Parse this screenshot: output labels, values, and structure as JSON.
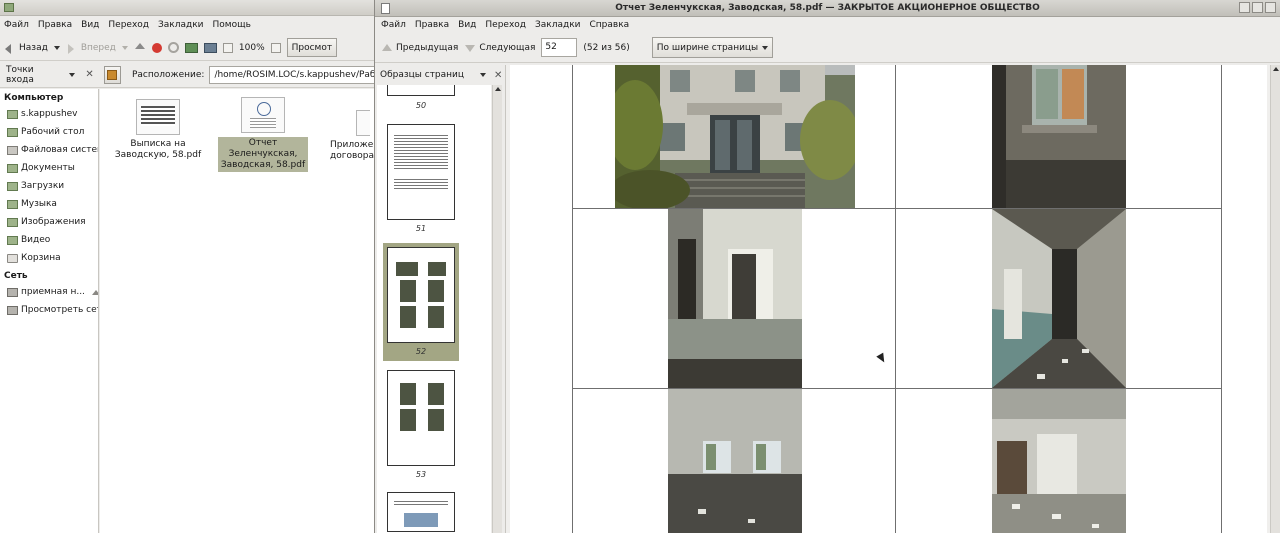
{
  "file_manager": {
    "menu": [
      "Файл",
      "Правка",
      "Вид",
      "Переход",
      "Закладки",
      "Помощь"
    ],
    "toolbar": {
      "back": "Назад",
      "forward": "Вперед",
      "zoom": "100%",
      "view": "Просмот"
    },
    "location": {
      "places_label": "Точки входа",
      "location_label": "Расположение:",
      "path": "/home/ROSIM.LOC/s.kappushev/Рабочий стол"
    },
    "sidebar": {
      "computer_head": "Компьютер",
      "computer_items": [
        "s.kappushev",
        "Рабочий стол",
        "Файловая система",
        "Документы",
        "Загрузки",
        "Музыка",
        "Изображения",
        "Видео",
        "Корзина"
      ],
      "network_head": "Сеть",
      "network_items": [
        "приемная н...",
        "Просмотреть сеть"
      ]
    },
    "files": [
      {
        "line1": "Выписка на",
        "line2": "Заводскую, 58.pdf"
      },
      {
        "line1": "Отчет Зеленчукская,",
        "line2": "Заводская, 58.pdf"
      },
      {
        "line1": "Приложен",
        "line2": "договора л"
      }
    ]
  },
  "pdf_viewer": {
    "title": "Отчет Зеленчукская, Заводская, 58.pdf — ЗАКРЫТОЕ АКЦИОНЕРНОЕ ОБЩЕСТВО",
    "menu": [
      "Файл",
      "Правка",
      "Вид",
      "Переход",
      "Закладки",
      "Справка"
    ],
    "toolbar": {
      "prev": "Предыдущая",
      "next": "Следующая",
      "page_value": "52",
      "page_of": "(52 из 56)",
      "zoom_mode": "По ширине страницы"
    },
    "side_panel": {
      "title": "Образцы страниц",
      "pages": [
        "50",
        "51",
        "52",
        "53"
      ],
      "selected_page": "52"
    }
  },
  "colors": {
    "selection": "#a3a684",
    "file_selection": "#b2b59b",
    "stop_icon": "#d43a32"
  }
}
